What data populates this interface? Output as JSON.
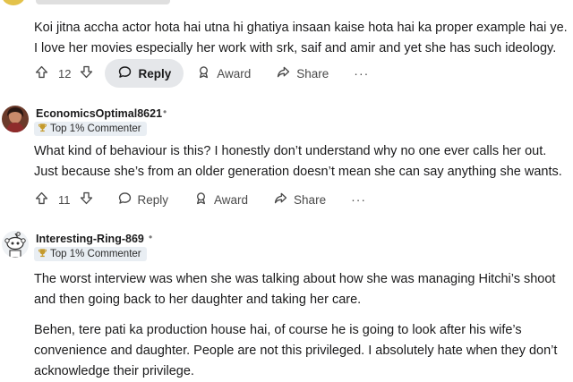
{
  "comments": [
    {
      "body": "Koi jitna accha actor hota hai utna hi ghatiya insaan kaise hota hai ka proper example hai ye. I love her movies especially her work with srk, saif and amir and yet she has such ideology.",
      "votes": "12",
      "reply_label": "Reply",
      "award_label": "Award",
      "share_label": "Share",
      "more_label": "···"
    },
    {
      "username": "EconomicsOptimal8621",
      "dot": "•",
      "badge": "Top 1% Commenter",
      "body": "What kind of behaviour is this? I honestly don’t understand why no one ever calls her out. Just because she’s from an older generation doesn’t mean she can say anything she wants.",
      "votes": "11",
      "reply_label": "Reply",
      "award_label": "Award",
      "share_label": "Share",
      "more_label": "···"
    },
    {
      "username": "Interesting-Ring-869",
      "dot": "•",
      "badge": "Top 1% Commenter",
      "paragraphs": [
        "The worst interview was when she was talking about how she was managing Hitchi’s shoot and then going back to her daughter and taking her care.",
        "Behen, tere pati ka production house hai, of course he is going to look after his wife’s convenience and daughter. People are not this privileged. I absolutely hate when they don’t acknowledge their privilege."
      ]
    }
  ],
  "colors": {
    "badge_bg": "#e9eef3",
    "reply_active_bg": "#e5e7ea",
    "text": "#1a1a1b",
    "muted": "#4a4a4a"
  }
}
